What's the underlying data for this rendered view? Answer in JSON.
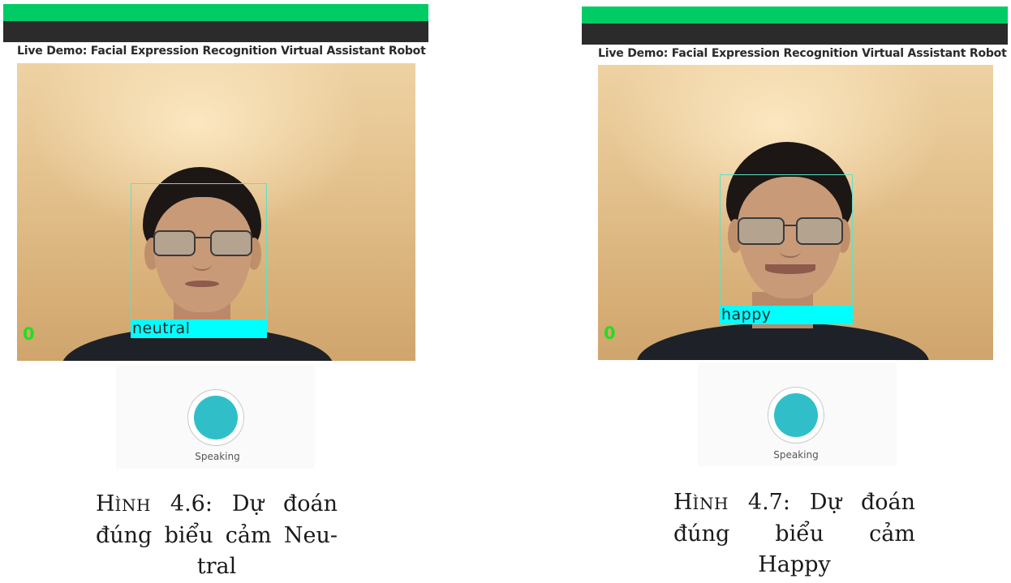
{
  "panels": [
    {
      "app_title": "Live Demo: Facial Expression Recognition Virtual Assistant Robot",
      "emotion_label": "neutral",
      "counter": "0",
      "voice_status": "Speaking",
      "caption": {
        "line1_prefix": "H",
        "line1_smallcaps": "ÌNH",
        "line1_rest": " 4.6: Dự đoán",
        "line2": "đúng biểu cảm Neu-",
        "line3": "tral"
      }
    },
    {
      "app_title": "Live Demo: Facial Expression Recognition Virtual Assistant Robot",
      "emotion_label": "happy",
      "counter": "0",
      "voice_status": "Speaking",
      "caption": {
        "line1_prefix": "H",
        "line1_smallcaps": "ÌNH",
        "line1_rest": " 4.7: Dự đoán",
        "line2": "đúng biểu cảm",
        "line3": "Happy"
      }
    }
  ],
  "colors": {
    "top_bar": "#00cc66",
    "title_bar": "#2b2b2b",
    "face_box": "#5fe0c8",
    "label_bg": "#00ffff",
    "counter": "#22dd22",
    "voice_dot": "#30bfc9"
  },
  "icons": {
    "voice": "speaking-orb-icon"
  }
}
